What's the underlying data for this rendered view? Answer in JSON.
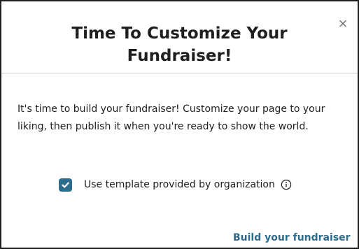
{
  "modal": {
    "title": "Time To Customize Your Fundraiser!",
    "close_glyph": "×",
    "body": "It's time to build your fundraiser! Customize your page to your liking, then publish it when you're ready to show the world.",
    "template_option": {
      "label": "Use template provided by organization",
      "checked": true,
      "info_icon": "info-circle-icon"
    },
    "primary_action": "Build your fundraiser"
  },
  "colors": {
    "accent": "#2c6d8e",
    "text": "#1f1f1f",
    "border": "#1f1f1f",
    "close_icon": "#666666"
  }
}
